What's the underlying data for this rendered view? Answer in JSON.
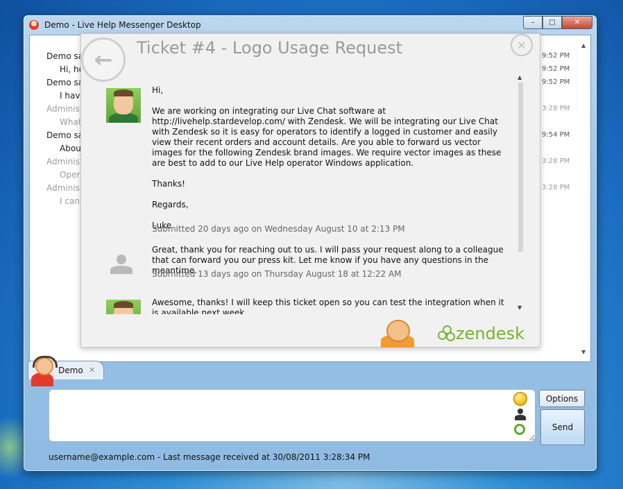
{
  "window": {
    "title": "Demo - Live Help Messenger Desktop",
    "controls": {
      "minimize": "–",
      "maximize": "□",
      "close": "✕"
    }
  },
  "chat": {
    "lines": [
      {
        "text": "Demo sa",
        "style": "name",
        "time": "9:52 PM"
      },
      {
        "text": "Hi, ho",
        "style": "sub",
        "time": "9:52 PM"
      },
      {
        "text": "Demo sa",
        "style": "name",
        "time": "9:52 PM"
      },
      {
        "text": "I have",
        "style": "sub",
        "time": ""
      },
      {
        "text": "Administ",
        "style": "grey",
        "time": "3:28 PM"
      },
      {
        "text": "What",
        "style": "grey",
        "time": ""
      },
      {
        "text": "Demo sa",
        "style": "name",
        "time": "9:54 PM"
      },
      {
        "text": "Abou",
        "style": "sub",
        "time": ""
      },
      {
        "text": "Administ",
        "style": "grey",
        "time": "3:28 PM"
      },
      {
        "text": "Oper",
        "style": "grey",
        "time": ""
      },
      {
        "text": "Administ",
        "style": "grey",
        "time": "3:28 PM"
      },
      {
        "text": "I can",
        "style": "grey",
        "time": ""
      }
    ]
  },
  "ticket": {
    "title": "Ticket #4 - Logo Usage Request",
    "back_icon": "arrow-left-icon",
    "close_label": "✕",
    "posts": [
      {
        "avatar": "user-avatar",
        "paragraphs": [
          "Hi,",
          "We are working on integrating our Live Chat software at http://livehelp.stardevelop.com/ with Zendesk.   We will be integrating our Live Chat with Zendesk so it is easy for operators to identify a logged in customer and easily view their recent orders and account details. Are you able to forward us vector images for the following Zendesk brand images.  We require vector images as these are best to add to our Live Help operator Windows application.",
          "Thanks!",
          "Regards,",
          "Luke"
        ],
        "meta": "Submitted 20 days ago on Wednesday August 10 at 2:13 PM"
      },
      {
        "avatar": "agent-avatar",
        "paragraphs": [
          "Great, thank you for reaching out to us.  I will pass your request along to a colleague that can forward you our press kit.  Let me know if you have any questions in the meantime."
        ],
        "meta": "Submitted 13 days ago on Thursday August 18 at 12:22 AM"
      },
      {
        "avatar": "user-avatar",
        "paragraphs": [
          "Awesome, thanks! I will keep this ticket open so you can test the integration when it is available next week."
        ],
        "meta": ""
      }
    ],
    "brand": "zendesk",
    "brand_color": "#78b12f"
  },
  "tab": {
    "label": "Demo",
    "close": "✕"
  },
  "compose": {
    "placeholder": ""
  },
  "buttons": {
    "options": "Options",
    "send": "Send"
  },
  "status": "username@example.com - Last message received at 30/08/2011 3:28:34 PM"
}
